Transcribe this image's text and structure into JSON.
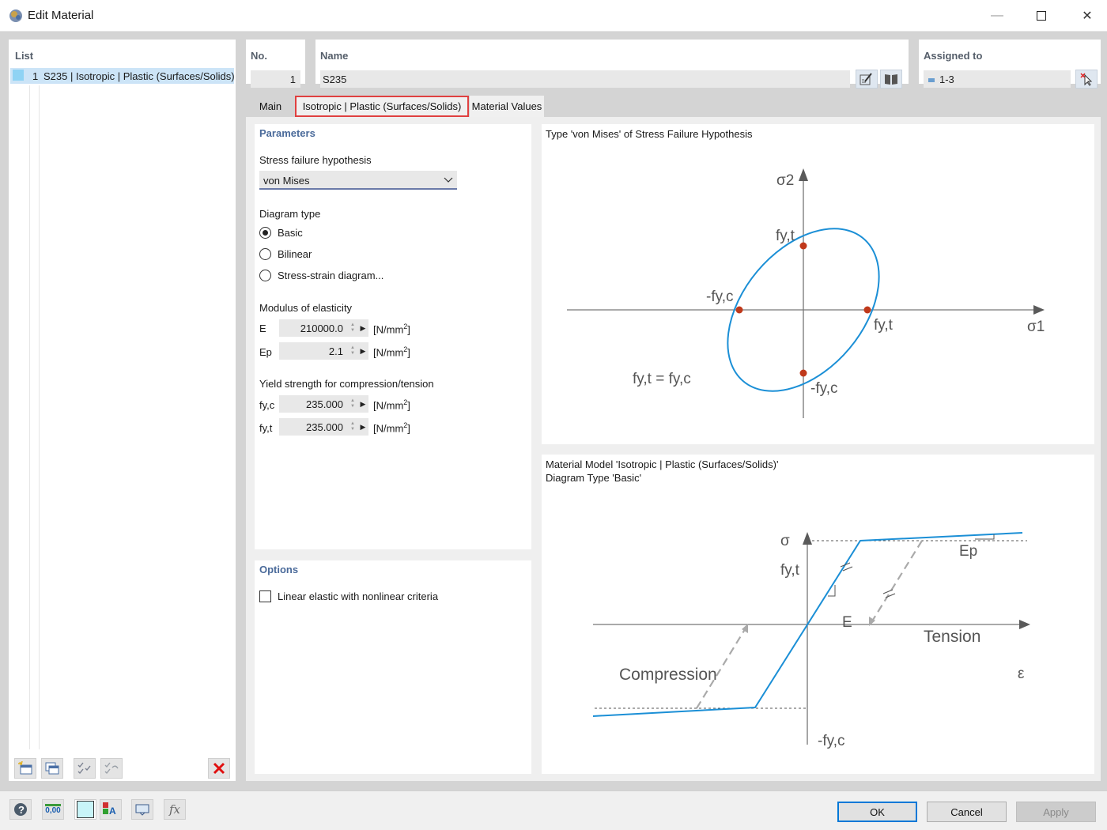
{
  "window": {
    "title": "Edit Material",
    "minimize_glyph": "—",
    "maximize_glyph": "☐",
    "close_glyph": "✕"
  },
  "list": {
    "header": "List",
    "items": [
      {
        "number": "1",
        "label": "S235 | Isotropic | Plastic (Surfaces/Solids)",
        "color": "#8fd3f4"
      }
    ]
  },
  "header": {
    "no_label": "No.",
    "no_value": "1",
    "name_label": "Name",
    "name_value": "S235",
    "assigned_label": "Assigned to",
    "assigned_value": "1-3"
  },
  "tabs": [
    {
      "label": "Main",
      "active": false
    },
    {
      "label": "Isotropic | Plastic (Surfaces/Solids)",
      "active": true
    },
    {
      "label": "Material Values",
      "active": false
    }
  ],
  "parameters": {
    "title": "Parameters",
    "stress_label": "Stress failure hypothesis",
    "stress_value": "von Mises",
    "diagram_label": "Diagram type",
    "diagram_options": [
      {
        "label": "Basic",
        "selected": true
      },
      {
        "label": "Bilinear",
        "selected": false
      },
      {
        "label": "Stress-strain diagram...",
        "selected": false
      }
    ],
    "modulus_label": "Modulus of elasticity",
    "E_label": "E",
    "E_value": "210000.0",
    "Ep_label": "Ep",
    "Ep_value": "2.1",
    "yield_label": "Yield strength for compression/tension",
    "fyc_label": "fy,c",
    "fyc_value": "235.000",
    "fyt_label": "fy,t",
    "fyt_value": "235.000",
    "unit": "[N/mm2]"
  },
  "options": {
    "title": "Options",
    "linear_label": "Linear elastic with nonlinear criteria",
    "linear_checked": false
  },
  "diagram_top": {
    "caption": "Type 'von Mises' of Stress Failure Hypothesis",
    "sigma2": "σ2",
    "sigma1": "σ1",
    "fyt_top": "fy,t",
    "fyt_right": "fy,t",
    "neg_fyc_left": "-fy,c",
    "neg_fyc_bottom": "-fy,c",
    "equation": "fy,t = fy,c"
  },
  "diagram_bottom": {
    "caption_line1": "Material Model 'Isotropic | Plastic (Surfaces/Solids)'",
    "caption_line2": "Diagram Type 'Basic'",
    "sigma": "σ",
    "epsilon": "ε",
    "fyt": "fy,t",
    "neg_fyc": "-fy,c",
    "E": "E",
    "Ep": "Ep",
    "tension": "Tension",
    "compression": "Compression"
  },
  "footer": {
    "ok": "OK",
    "cancel": "Cancel",
    "apply": "Apply",
    "number_icon_text": "0,00"
  },
  "colors": {
    "accent": "#1b8fd6",
    "point": "#c0391b",
    "active_tab_border": "#e04040"
  }
}
